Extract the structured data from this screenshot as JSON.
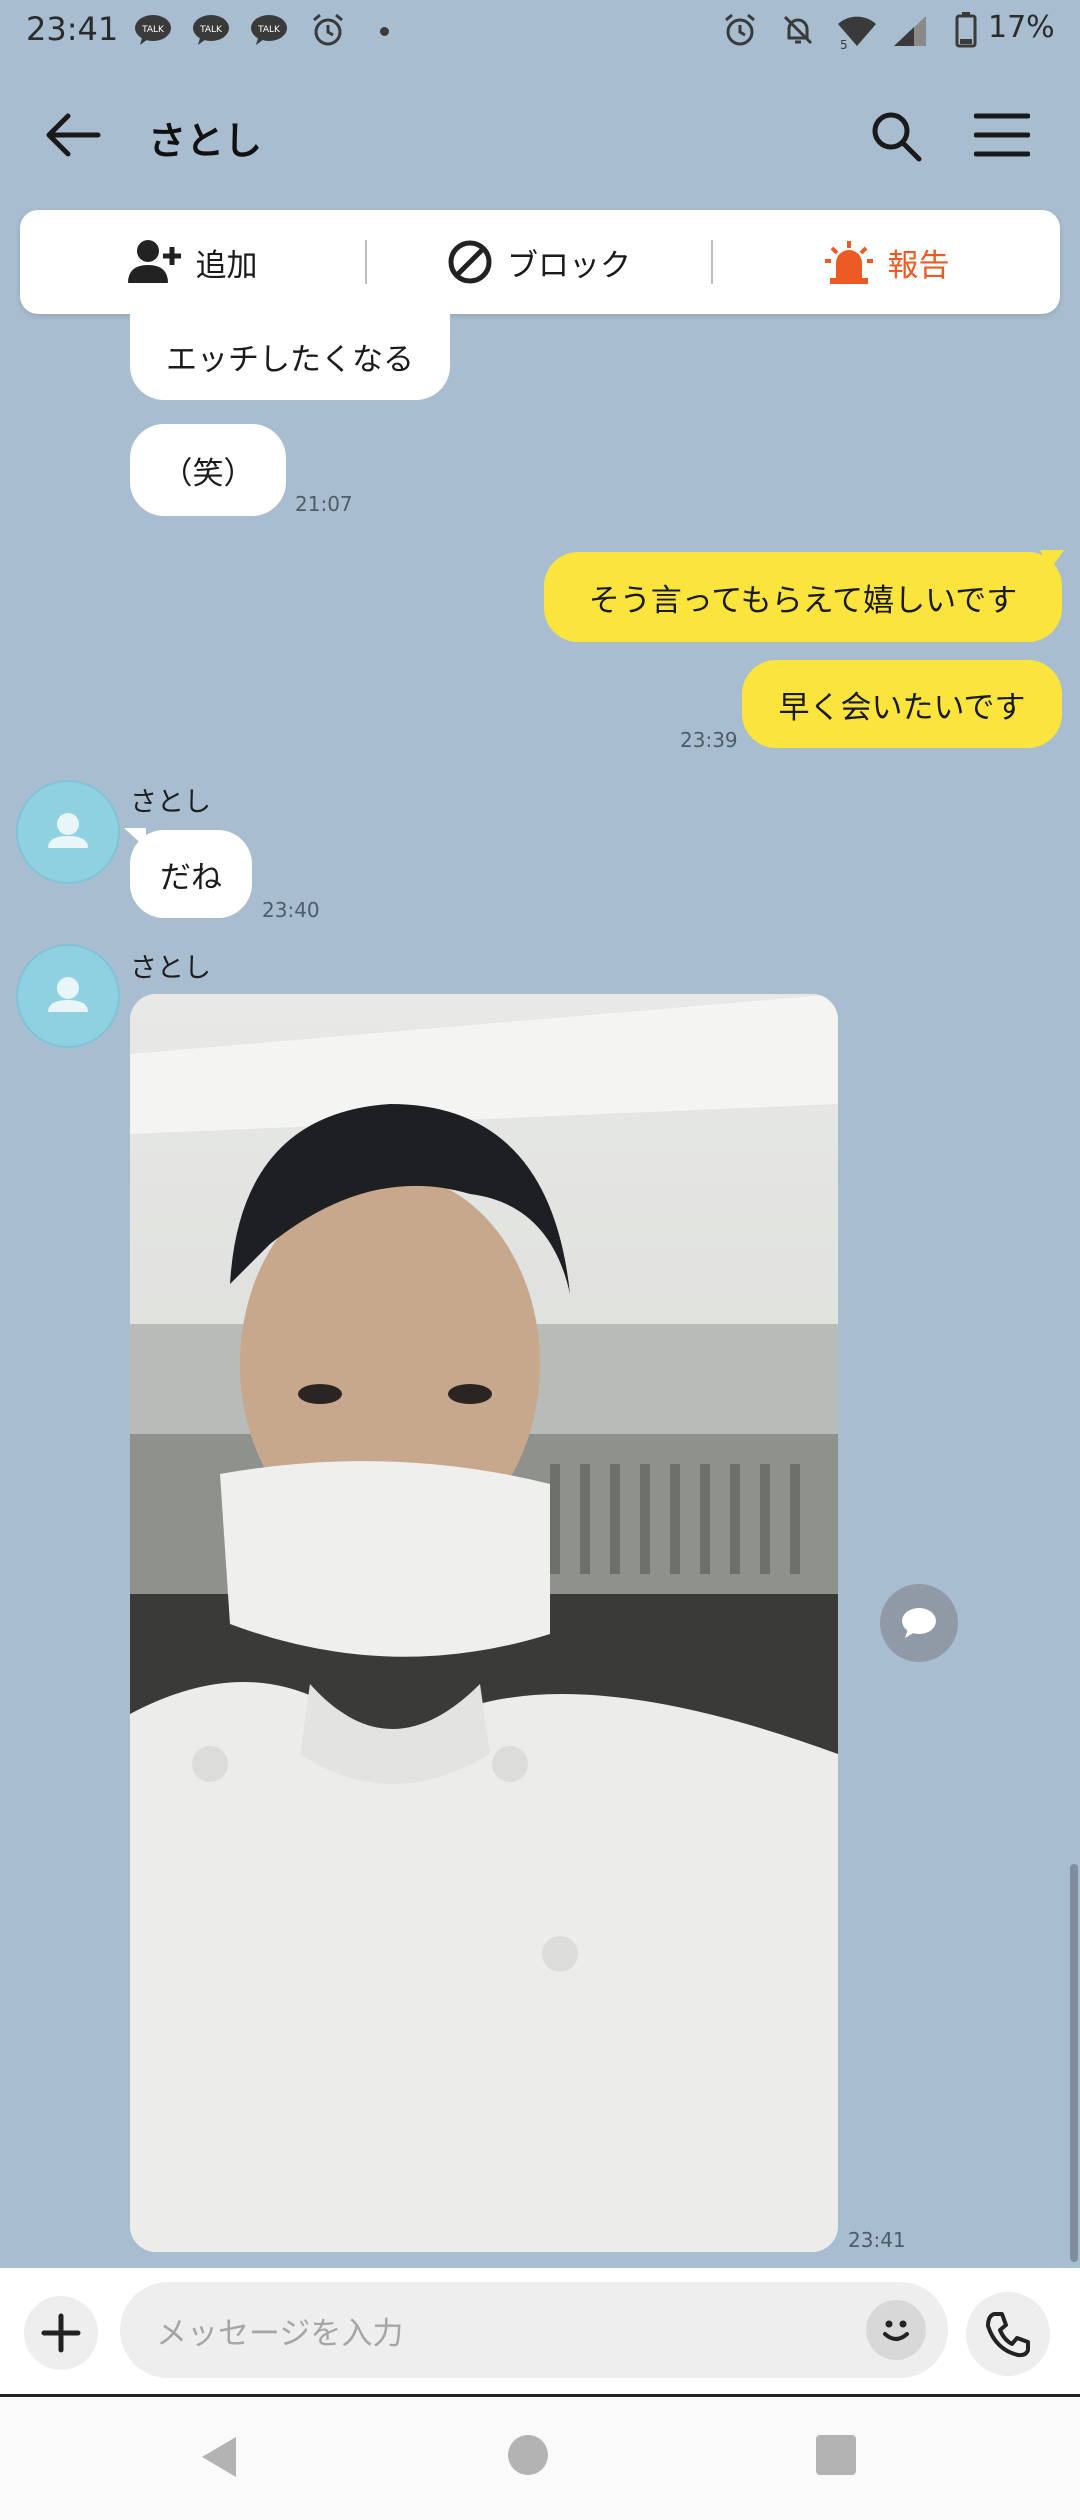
{
  "status_bar": {
    "time": "23:41",
    "talk_label": "TALK",
    "battery": "17%",
    "signal_label": "5"
  },
  "header": {
    "title": "さとし"
  },
  "action_bar": {
    "add_label": "追加",
    "block_label": "ブロック",
    "report_label": "報告",
    "report_color": "#ee5a24"
  },
  "messages": [
    {
      "side": "them",
      "text": "エッチしたくなる",
      "time": ""
    },
    {
      "side": "them",
      "text": "（笑）",
      "time": "21:07"
    },
    {
      "side": "me",
      "text": "そう言ってもらえて嬉しいです",
      "time": ""
    },
    {
      "side": "me",
      "text": "早く会いたいです",
      "time": "23:39"
    },
    {
      "side": "them",
      "sender": "さとし",
      "text": "だね",
      "time": "23:40"
    },
    {
      "side": "them",
      "sender": "さとし",
      "type": "photo",
      "time": "23:41"
    }
  ],
  "input": {
    "placeholder": "メッセージを入力"
  },
  "colors": {
    "background": "#a9bdd0",
    "my_bubble": "#fbe53d",
    "their_bubble": "#ffffff",
    "avatar": "#8fd0e1"
  }
}
